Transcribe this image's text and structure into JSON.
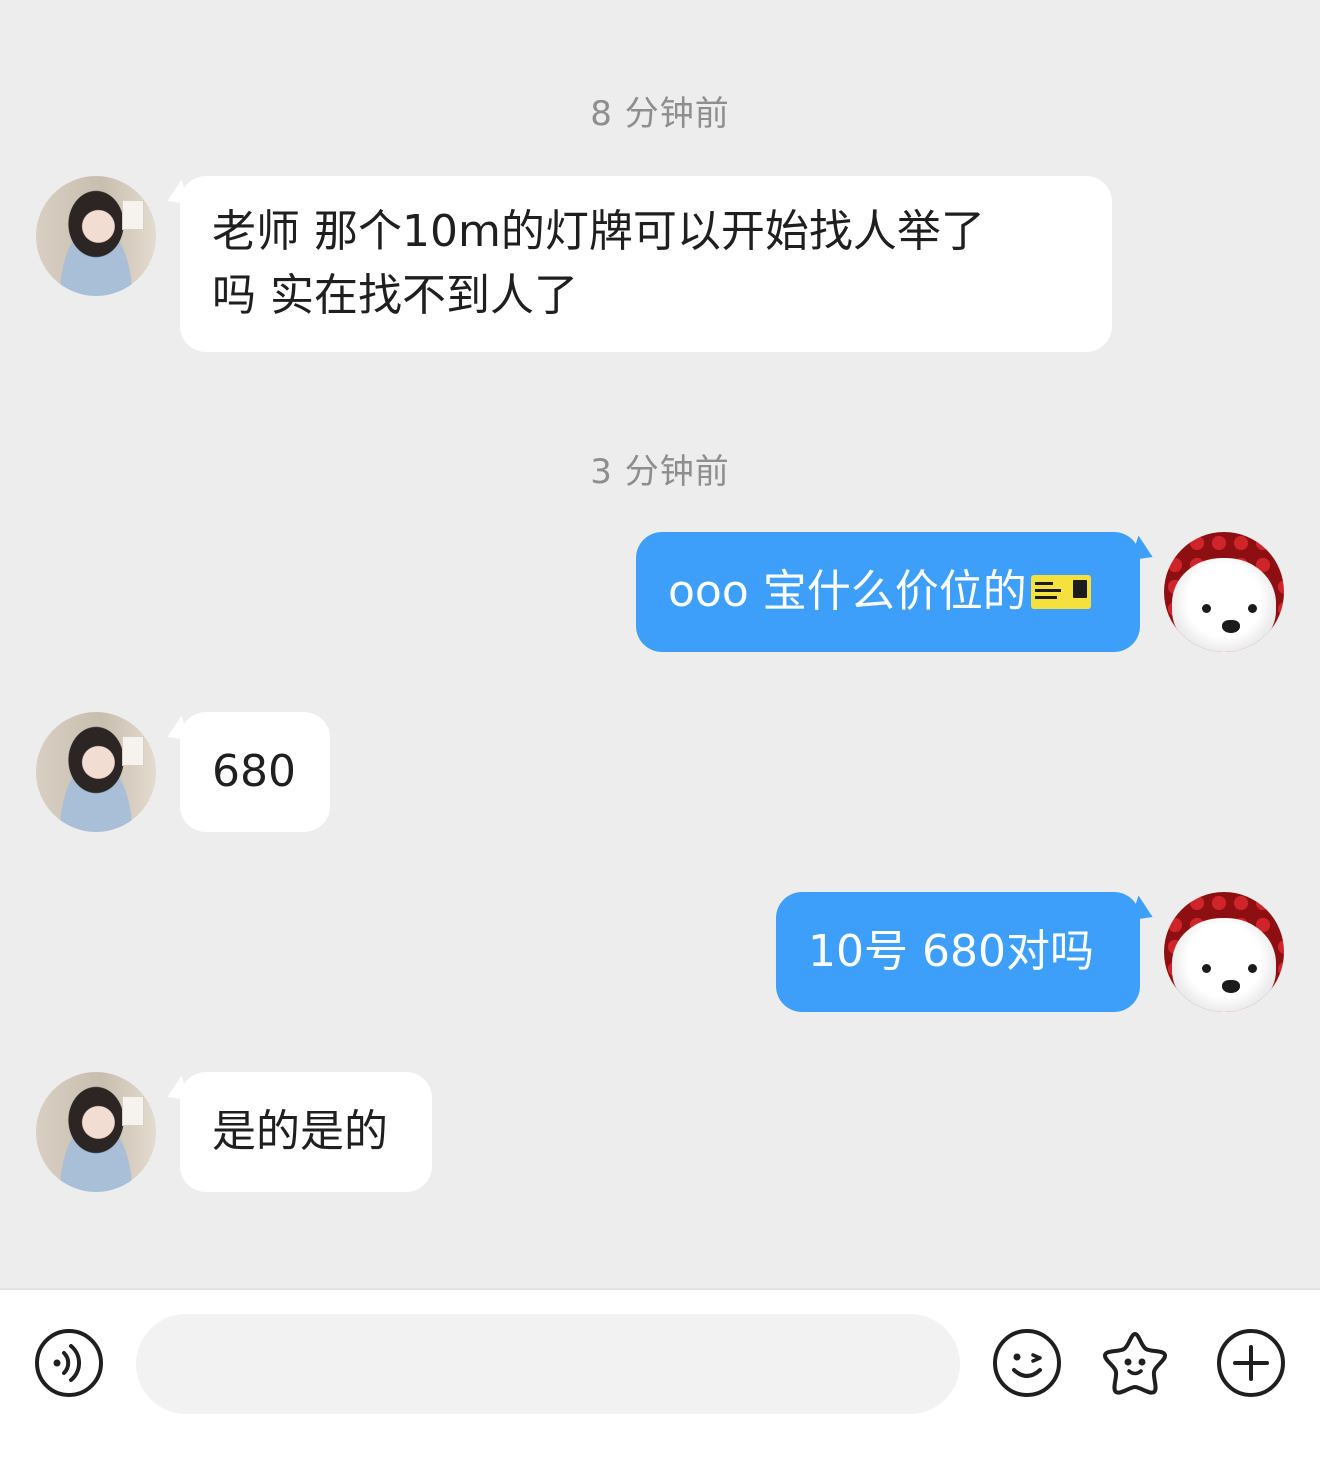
{
  "timestamps": [
    "8 分钟前",
    "3 分钟前"
  ],
  "messages": [
    {
      "text": "老师 那个10m的灯牌可以开始找人举了\n吗 实在找不到人了"
    },
    {
      "text": "ooo 宝什么价位的",
      "emoji": "ticket-emoji"
    },
    {
      "text": "680"
    },
    {
      "text": "10号 680对吗"
    },
    {
      "text": "是的是的"
    }
  ],
  "ticket_emoji": {
    "lines": [
      "LIVE",
      "CONCERT",
      "TICKET ♫"
    ],
    "zone_label": "ZONE",
    "zone": "A"
  },
  "input": {
    "value": "",
    "placeholder": ""
  },
  "colors": {
    "outgoing_bubble": "#3d9ffa",
    "incoming_bubble": "#ffffff",
    "background": "#ededed"
  },
  "icons": [
    "voice-icon",
    "emoji-smile-icon",
    "sticker-star-icon",
    "add-icon"
  ]
}
